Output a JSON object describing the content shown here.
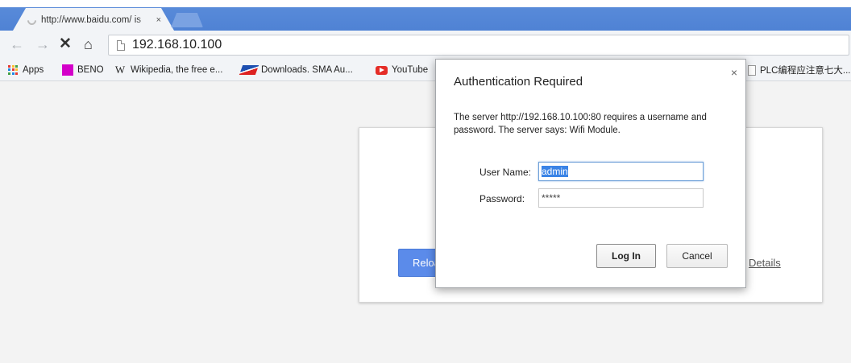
{
  "tabs": [
    {
      "title": "http://www.baidu.com/ is",
      "close_icon": "×"
    }
  ],
  "toolbar": {
    "back_icon": "←",
    "forward_icon": "→",
    "stop_icon": "✕",
    "home_icon": "⌂",
    "url": "192.168.10.100"
  },
  "bookmarks": [
    {
      "label": "Apps",
      "icon": "apps-grid-icon"
    },
    {
      "label": "BENO",
      "icon": "beno-icon"
    },
    {
      "label": "Wikipedia, the free e...",
      "icon": "wikipedia-icon"
    },
    {
      "label": "Downloads. SMA Au...",
      "icon": "sma-icon"
    },
    {
      "label": "YouTube",
      "icon": "youtube-icon"
    },
    {
      "label": "PLC编程应注意七大...",
      "icon": "page-icon"
    }
  ],
  "page": {
    "reload_label": "Reload",
    "details_label": "Details"
  },
  "dialog": {
    "title": "Authentication Required",
    "close_icon": "×",
    "message": "The server http://192.168.10.100:80 requires a username and password. The server says: Wifi Module.",
    "username_label": "User Name:",
    "username_value": "admin",
    "password_label": "Password:",
    "password_value": "*****",
    "login_label": "Log In",
    "cancel_label": "Cancel"
  },
  "colors": {
    "tabstrip": "#5b8ddb",
    "reload_button": "#5b8bea",
    "selection": "#3b84e6"
  }
}
